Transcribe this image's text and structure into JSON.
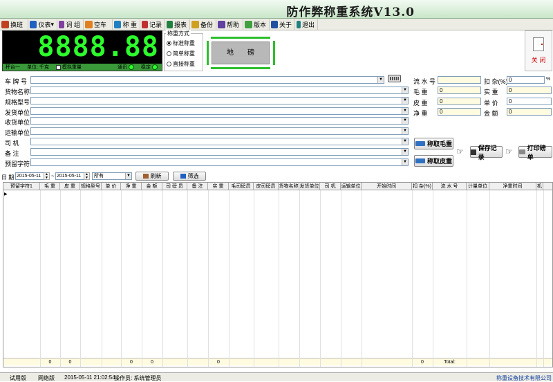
{
  "app": {
    "title": "防作弊称重系统V13.0"
  },
  "toolbar": [
    {
      "label": "换班",
      "icon": "shift-icon",
      "color": "#c04020"
    },
    {
      "label": "仪表",
      "icon": "meter-icon",
      "color": "#2060c0"
    },
    {
      "label": "词 组",
      "icon": "phrase-icon",
      "color": "#8040a0"
    },
    {
      "label": "空车",
      "icon": "truck-icon",
      "color": "#e08020"
    },
    {
      "label": "称 重",
      "icon": "weigh-icon",
      "color": "#2080c0"
    },
    {
      "label": "记录",
      "icon": "record-icon",
      "color": "#c03030"
    },
    {
      "label": "报表",
      "icon": "report-icon",
      "color": "#208040"
    },
    {
      "label": "备份",
      "icon": "backup-icon",
      "color": "#d0a020"
    },
    {
      "label": "帮助",
      "icon": "help-icon",
      "color": "#6040a0"
    },
    {
      "label": "版本",
      "icon": "version-icon",
      "color": "#40a040"
    },
    {
      "label": "关于",
      "icon": "about-icon",
      "color": "#2050a0"
    },
    {
      "label": "退出",
      "icon": "exit-icon",
      "color": "#208080"
    }
  ],
  "scale": {
    "weight": "8888.88",
    "platform": "秤台一",
    "unit": "单位: 千克",
    "simulate": "模拟重量",
    "comm": "通讯",
    "stable": "稳定"
  },
  "mode": {
    "title": "称重方式",
    "options": [
      {
        "label": "标准称重",
        "selected": true
      },
      {
        "label": "简单称重",
        "selected": false
      },
      {
        "label": "直接称重",
        "selected": false
      }
    ]
  },
  "platform_pic": {
    "label": "地　　磅"
  },
  "close": {
    "label": "关  闭"
  },
  "form": {
    "fields": [
      {
        "label": "车 牌 号",
        "value": ""
      },
      {
        "label": "货物名称",
        "value": ""
      },
      {
        "label": "规格型号",
        "value": ""
      },
      {
        "label": "发货单位",
        "value": ""
      },
      {
        "label": "收货单位",
        "value": ""
      },
      {
        "label": "运输单位",
        "value": ""
      },
      {
        "label": "司    机",
        "value": ""
      },
      {
        "label": "备    注",
        "value": ""
      },
      {
        "label": "预留字符1",
        "value": ""
      }
    ]
  },
  "right": {
    "serial": {
      "label": "流 水 号",
      "value": ""
    },
    "deduct": {
      "label": "扣 杂(%)",
      "value": "0",
      "suffix": "%"
    },
    "gross": {
      "label": "毛    重",
      "value": "0"
    },
    "net_real": {
      "label": "实    重",
      "value": "0"
    },
    "tare": {
      "label": "皮    重",
      "value": "0"
    },
    "price": {
      "label": "单    价",
      "value": "0"
    },
    "net": {
      "label": "净    重",
      "value": "0"
    },
    "amount": {
      "label": "金    额",
      "value": "0"
    }
  },
  "buttons": {
    "gross": "称取毛重",
    "tare": "称取皮重",
    "save": "保存记录",
    "print": "打印磅单"
  },
  "filter": {
    "date_label": "日 期",
    "from": "2015-05-11",
    "sep": "~",
    "to": "2015-05-11",
    "select": "所有",
    "refresh": "刷新",
    "filter": "筛选"
  },
  "grid": {
    "columns": [
      "预留字符1",
      "毛 重",
      "皮 重",
      "规格型号",
      "单 价",
      "净 重",
      "金 额",
      "司 磅 员",
      "备 注",
      "实 重",
      "毛司磅员",
      "皮司磅员",
      "货物名称",
      "发货单位",
      "司 机",
      "运输单位",
      "开始时间",
      "扣 杂(%)",
      "流 水 号",
      "计量单位",
      "净重时间",
      "机"
    ],
    "footer": [
      "0",
      "0",
      "0",
      "0",
      "0",
      "0",
      "Total:"
    ]
  },
  "status": {
    "trial": "试用版",
    "network": "网络版",
    "time": "2015-05-11 21:02:54",
    "operator": "操作员: 系统管理员",
    "company": "称重设备技术有限公司"
  }
}
